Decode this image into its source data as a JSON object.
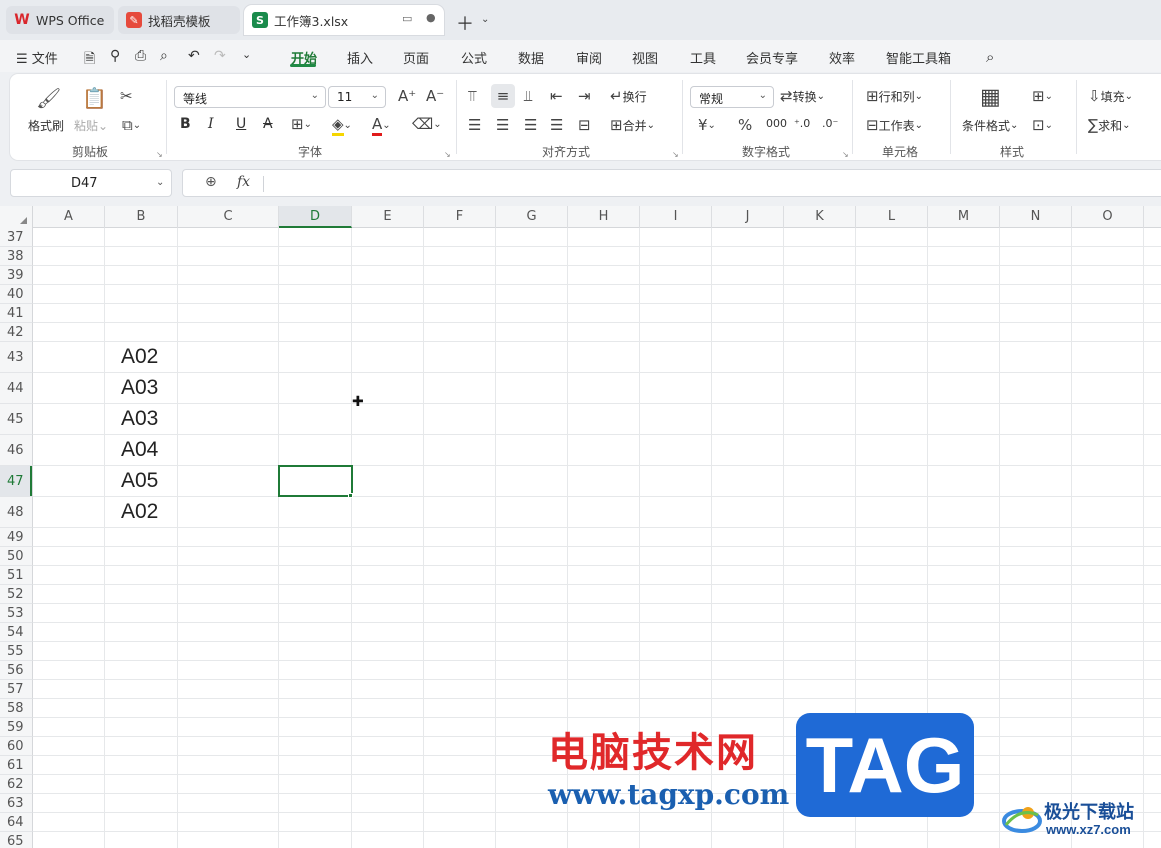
{
  "tabs": [
    {
      "label": "WPS Office",
      "icon": "wps-logo-icon"
    },
    {
      "label": "找稻壳模板",
      "icon": "docer-icon"
    },
    {
      "label": "工作簿3.xlsx",
      "icon": "spreadsheet-s-icon"
    }
  ],
  "menu": {
    "file": "文件",
    "items": [
      "开始",
      "插入",
      "页面",
      "公式",
      "数据",
      "审阅",
      "视图",
      "工具",
      "会员专享",
      "效率",
      "智能工具箱"
    ],
    "active": "开始"
  },
  "ribbon": {
    "clipboard": {
      "label": "剪贴板",
      "format_painter": "格式刷",
      "paste": "粘贴"
    },
    "font": {
      "label": "字体",
      "font_name": "等线",
      "font_size": "11"
    },
    "align": {
      "label": "对齐方式",
      "wrap": "换行",
      "merge": "合并"
    },
    "number": {
      "label": "数字格式",
      "format": "常规",
      "convert": "转换"
    },
    "cells": {
      "label": "单元格",
      "rows_cols": "行和列",
      "worksheet": "工作表"
    },
    "styles": {
      "label": "样式",
      "conditional": "条件格式"
    },
    "edit": {
      "fill": "填充",
      "sum": "求和"
    }
  },
  "formula_bar": {
    "cell_ref": "D47",
    "fx": "fx",
    "value": ""
  },
  "grid": {
    "columns": [
      "A",
      "B",
      "C",
      "D",
      "E",
      "F",
      "G",
      "H",
      "I",
      "J",
      "K",
      "L",
      "M",
      "N",
      "O"
    ],
    "selected_column": "D",
    "selected_row": "47",
    "rows": [
      "37",
      "38",
      "39",
      "40",
      "41",
      "42",
      "43",
      "44",
      "45",
      "46",
      "47",
      "48",
      "49",
      "50",
      "51",
      "52",
      "53",
      "54",
      "55",
      "56",
      "57",
      "58",
      "59",
      "60",
      "61",
      "62",
      "63",
      "64",
      "65"
    ],
    "cells_B": {
      "43": "A02",
      "44": "A03",
      "45": "A03",
      "46": "A04",
      "47": "A05",
      "48": "A02"
    }
  },
  "watermark": {
    "site_cn": "电脑技术网",
    "site_url": "www.tagxp.com",
    "tag": "TAG",
    "xz_cn": "极光下载站",
    "xz_url": "www.xz7.com"
  },
  "colors": {
    "accent": "#1f7a37",
    "wm_red": "#e0282a",
    "wm_blue": "#1f6ad6"
  }
}
